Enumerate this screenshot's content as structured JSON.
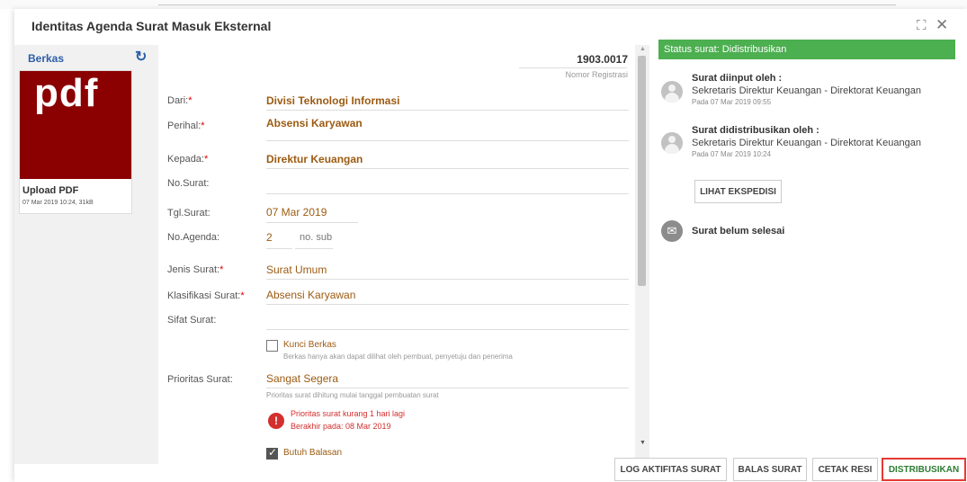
{
  "dialog": {
    "title": "Identitas Agenda Surat Masuk Eksternal"
  },
  "files": {
    "title": "Berkas",
    "thumb_text": "pdf",
    "upload_title": "Upload PDF",
    "upload_meta": "07 Mar 2019 10:24, 31kB"
  },
  "form": {
    "reg_number": "1903.0017",
    "reg_label": "Nomor Registrasi",
    "dari_label": "Dari:",
    "dari_value": "Divisi Teknologi Informasi",
    "perihal_label": "Perihal:",
    "perihal_value": "Absensi Karyawan",
    "kepada_label": "Kepada:",
    "kepada_value": "Direktur Keuangan",
    "nosurat_label": "No.Surat:",
    "tgl_label": "Tgl.Surat:",
    "tgl_value": "07 Mar 2019",
    "noagenda_label": "No.Agenda:",
    "noagenda_value": "2",
    "nosub_placeholder": "no. sub",
    "jenis_label": "Jenis Surat:",
    "jenis_value": "Surat Umum",
    "klasifikasi_label": "Klasifikasi Surat:",
    "klasifikasi_value": "Absensi Karyawan",
    "sifat_label": "Sifat Surat:",
    "kunci_label": "Kunci Berkas",
    "kunci_hint": "Berkas hanya akan dapat dilihat oleh pembuat, penyetuju dan penerima",
    "prioritas_label": "Prioritas Surat:",
    "prioritas_value": "Sangat Segera",
    "prioritas_hint": "Prioritas surat dihitung mulai tanggal pembuatan surat",
    "warn_line1": "Prioritas surat kurang 1 hari lagi",
    "warn_line2": "Berakhir pada: 08 Mar 2019",
    "balasan_label": "Butuh Balasan",
    "kunci_checked": false,
    "balasan_checked": true
  },
  "status": {
    "header": "Status surat: Didistribusikan",
    "entries": [
      {
        "title": "Surat diinput oleh :",
        "text": "Sekretaris Direktur Keuangan - Direktorat Keuangan",
        "date": "Pada 07 Mar 2019 09:55"
      },
      {
        "title": "Surat didistribusikan oleh :",
        "text": "Sekretaris Direktur Keuangan - Direktorat Keuangan",
        "date": "Pada 07 Mar 2019 10:24"
      }
    ],
    "ekspedisi_button": "LIHAT EKSPEDISI",
    "final_text": "Surat belum selesai",
    "header_color": "#4caf50"
  },
  "footer": {
    "log": "LOG AKTIFITAS SURAT",
    "balas": "BALAS SURAT",
    "cetak": "CETAK RESI",
    "distribusi": "DISTRIBUSIKAN"
  }
}
